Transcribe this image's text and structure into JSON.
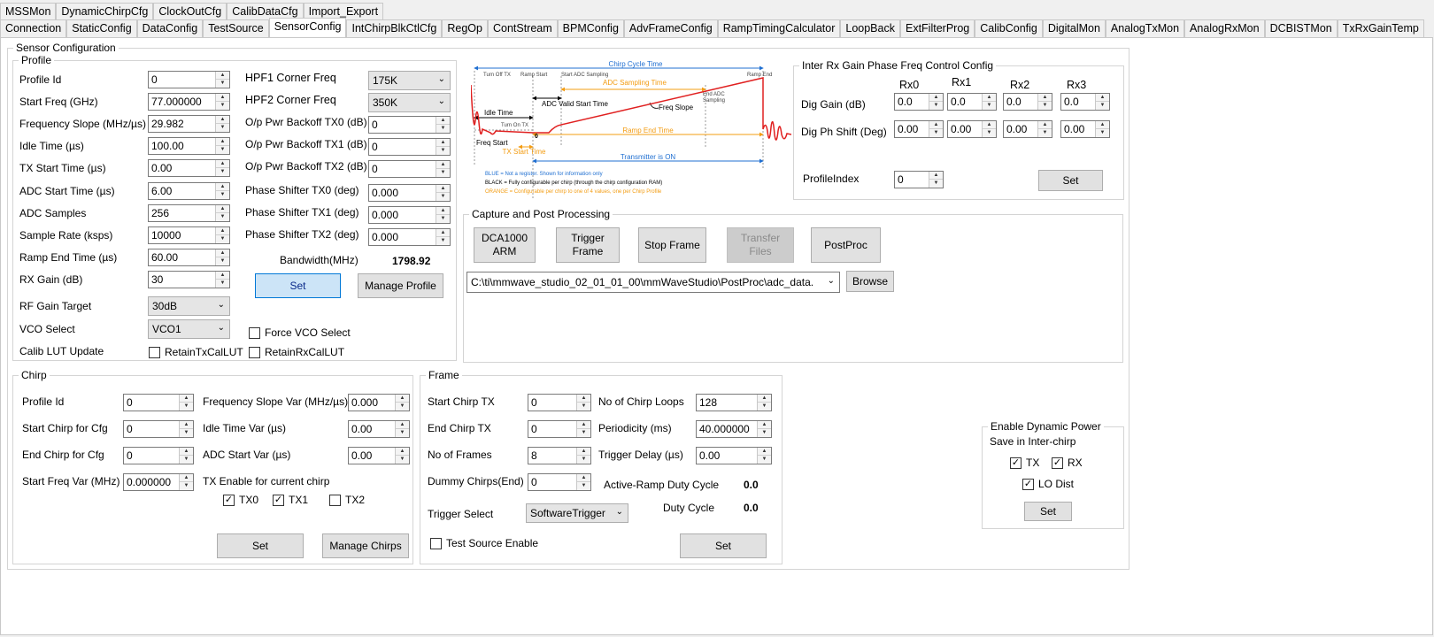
{
  "top_tabs": [
    "MSSMon",
    "DynamicChirpCfg",
    "ClockOutCfg",
    "CalibDataCfg",
    "Import_Export"
  ],
  "second_tabs": [
    "Connection",
    "StaticConfig",
    "DataConfig",
    "TestSource",
    "SensorConfig",
    "IntChirpBlkCtlCfg",
    "RegOp",
    "ContStream",
    "BPMConfig",
    "AdvFrameConfig",
    "RampTimingCalculator",
    "LoopBack",
    "ExtFilterProg",
    "CalibConfig",
    "DigitalMon",
    "AnalogTxMon",
    "AnalogRxMon",
    "DCBISTMon",
    "TxRxGainTemp"
  ],
  "active_tab": "SensorConfig",
  "sensor_title": "Sensor Configuration",
  "profile": {
    "title": "Profile",
    "left_fields": [
      {
        "label": "Profile Id",
        "value": "0"
      },
      {
        "label": "Start Freq (GHz)",
        "value": "77.000000"
      },
      {
        "label": "Frequency Slope (MHz/µs)",
        "value": "29.982"
      },
      {
        "label": "Idle Time (µs)",
        "value": "100.00"
      },
      {
        "label": "TX Start Time (µs)",
        "value": "0.00"
      },
      {
        "label": "ADC Start Time (µs)",
        "value": "6.00"
      },
      {
        "label": "ADC Samples",
        "value": "256"
      },
      {
        "label": "Sample Rate (ksps)",
        "value": "10000"
      },
      {
        "label": "Ramp End Time (µs)",
        "value": "60.00"
      },
      {
        "label": "RX Gain (dB)",
        "value": "30"
      }
    ],
    "rf_gain_target": {
      "label": "RF Gain Target",
      "value": "30dB"
    },
    "vco_select": {
      "label": "VCO Select",
      "value": "VCO1"
    },
    "calib_lut_label": "Calib LUT Update",
    "retain_tx": "RetainTxCalLUT",
    "retain_rx": "RetainRxCalLUT",
    "force_vco": "Force VCO Select",
    "hpf1": {
      "label": "HPF1 Corner Freq",
      "value": "175K"
    },
    "hpf2": {
      "label": "HPF2 Corner Freq",
      "value": "350K"
    },
    "right_fields": [
      {
        "label": "O/p Pwr Backoff TX0 (dB)",
        "value": "0"
      },
      {
        "label": "O/p Pwr Backoff TX1 (dB)",
        "value": "0"
      },
      {
        "label": "O/p Pwr Backoff TX2 (dB)",
        "value": "0"
      },
      {
        "label": "Phase Shifter TX0 (deg)",
        "value": "0.000"
      },
      {
        "label": "Phase Shifter TX1 (deg)",
        "value": "0.000"
      },
      {
        "label": "Phase Shifter TX2 (deg)",
        "value": "0.000"
      }
    ],
    "bandwidth_label": "Bandwidth(MHz)",
    "bandwidth_value": "1798.92",
    "set_label": "Set",
    "manage_label": "Manage Profile"
  },
  "diagram": {
    "chirp_cycle": "Chirp Cycle Time",
    "turn_off_tx": "Turn Off TX",
    "ramp_start": "Ramp Start",
    "start_adc": "Start ADC Sampling",
    "ramp_end": "Ramp End",
    "end_adc_1": "End ADC",
    "end_adc_2": "Sampling",
    "adc_sampling_time": "ADC Sampling Time",
    "adc_valid_start": "ADC Valid Start Time",
    "idle_time": "Idle Time",
    "freq_slope": "Freq Slope",
    "turn_on_tx": "Turn On TX",
    "zero": "0",
    "ramp_end_time": "Ramp End Time",
    "freq_start": "Freq Start",
    "tx_start_time": "TX Start Time",
    "transmitter_on": "Transmitter is ON",
    "legend_blue": "BLUE = Not a register. Shown for information only",
    "legend_black": "BLACK = Fully configurable per chirp (through the chirp configuration RAM)",
    "legend_orange": "ORANGE = Configurable per chirp to one of 4 values, one per Chirp Profile",
    "colors": {
      "blue": "#1f6fd1",
      "orange": "#f39c12",
      "red": "#e02020"
    }
  },
  "gain_phase": {
    "title": "Inter Rx Gain Phase Freq Control Config",
    "columns": [
      "Rx0",
      "Rx1",
      "Rx2",
      "Rx3"
    ],
    "dig_gain_label": "Dig Gain (dB)",
    "dig_gain": [
      "0.0",
      "0.0",
      "0.0",
      "0.0"
    ],
    "dig_ph_label": "Dig Ph Shift (Deg)",
    "dig_ph": [
      "0.00",
      "0.00",
      "0.00",
      "0.00"
    ],
    "profile_index_label": "ProfileIndex",
    "profile_index": "0",
    "set_label": "Set"
  },
  "capture": {
    "title": "Capture and Post Processing",
    "dca_label": "DCA1000\nARM",
    "trigger_label": "Trigger\nFrame",
    "stop_label": "Stop Frame",
    "transfer_label": "Transfer\nFiles",
    "postproc_label": "PostProc",
    "path": "C:\\ti\\mmwave_studio_02_01_01_00\\mmWaveStudio\\PostProc\\adc_data.",
    "browse_label": "Browse"
  },
  "chirp": {
    "title": "Chirp",
    "left_fields": [
      {
        "label": "Profile Id",
        "value": "0"
      },
      {
        "label": "Start Chirp for Cfg",
        "value": "0"
      },
      {
        "label": "End Chirp for Cfg",
        "value": "0"
      },
      {
        "label": "Start Freq Var (MHz)",
        "value": "0.000000"
      }
    ],
    "right_fields": [
      {
        "label": "Frequency Slope Var (MHz/µs)",
        "value": "0.000"
      },
      {
        "label": "Idle Time Var (µs)",
        "value": "0.00"
      },
      {
        "label": "ADC Start Var (µs)",
        "value": "0.00"
      }
    ],
    "tx_enable_label": "TX Enable for current chirp",
    "tx0": "TX0",
    "tx1": "TX1",
    "tx2": "TX2",
    "tx_checked": [
      true,
      true,
      false
    ],
    "set_label": "Set",
    "manage_label": "Manage Chirps"
  },
  "frame": {
    "title": "Frame",
    "left_fields": [
      {
        "label": "Start Chirp TX",
        "value": "0"
      },
      {
        "label": "End Chirp TX",
        "value": "0"
      },
      {
        "label": "No of Frames",
        "value": "8"
      },
      {
        "label": "Dummy Chirps(End)",
        "value": "0"
      }
    ],
    "right_fields": [
      {
        "label": "No of Chirp Loops",
        "value": "128"
      },
      {
        "label": "Periodicity (ms)",
        "value": "40.000000"
      },
      {
        "label": "Trigger Delay (µs)",
        "value": "0.00"
      }
    ],
    "active_ramp_label": "Active-Ramp Duty Cycle",
    "active_ramp_value": "0.0",
    "duty_label": "Duty Cycle",
    "duty_value": "0.0",
    "trigger_select_label": "Trigger Select",
    "trigger_select_value": "SoftwareTrigger",
    "test_source_label": "Test Source Enable",
    "set_label": "Set"
  },
  "power_save": {
    "title_1": "Enable Dynamic Power",
    "title_2": "Save in Inter-chirp",
    "tx": "TX",
    "rx": "RX",
    "lo": "LO Dist",
    "set_label": "Set"
  }
}
